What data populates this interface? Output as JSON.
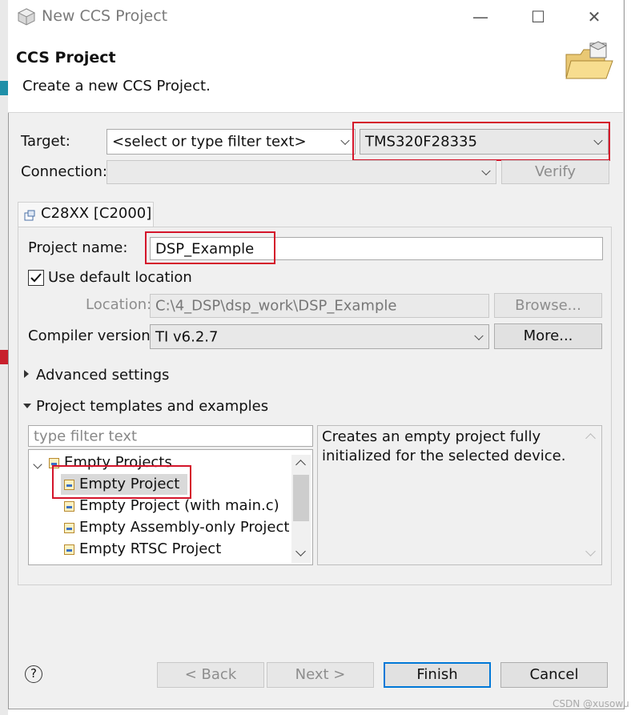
{
  "window": {
    "title": "New CCS Project",
    "minimize": "—",
    "maximize": "☐",
    "close": "✕"
  },
  "header": {
    "title": "CCS Project",
    "description": "Create a new CCS Project."
  },
  "target": {
    "label": "Target:",
    "filter_placeholder": "<select or type filter text>",
    "device": "TMS320F28335"
  },
  "connection": {
    "label": "Connection:",
    "value": "",
    "verify_label": "Verify"
  },
  "tab": {
    "label": "C28XX [C2000]"
  },
  "project": {
    "name_label": "Project name:",
    "name_value": "DSP_Example",
    "use_default_label": "Use default location",
    "use_default_checked": true,
    "location_label": "Location:",
    "location_value": "C:\\4_DSP\\dsp_work\\DSP_Example",
    "browse_label": "Browse...",
    "compiler_label": "Compiler version:",
    "compiler_value": "TI v6.2.7",
    "more_label": "More..."
  },
  "advanced": {
    "label": "Advanced settings",
    "expanded": false
  },
  "templates": {
    "label": "Project templates and examples",
    "expanded": true,
    "filter_placeholder": "type filter text",
    "group": "Empty Projects",
    "items": [
      "Empty Project",
      "Empty Project (with main.c)",
      "Empty Assembly-only Project",
      "Empty RTSC Project"
    ],
    "selected": "Empty Project",
    "description": [
      "Creates an empty project fully",
      "initialized for the selected device."
    ]
  },
  "footer": {
    "help": "?",
    "back_label": "< Back",
    "next_label": "Next >",
    "finish_label": "Finish",
    "cancel_label": "Cancel"
  },
  "watermark": "CSDN @xusowu",
  "colors": {
    "highlight": "#d4142a",
    "primary_border": "#0078d7"
  }
}
